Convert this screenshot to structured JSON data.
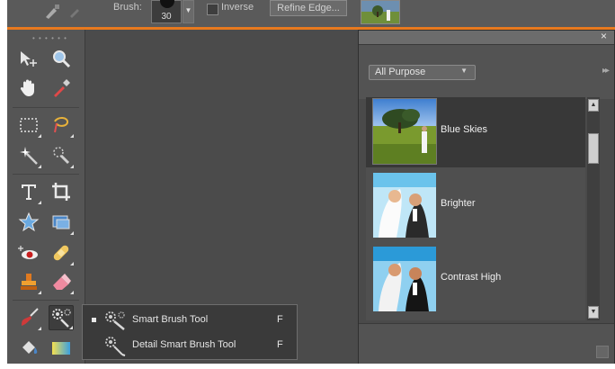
{
  "options_bar": {
    "brush_label": "Brush:",
    "brush_size": "30",
    "inverse_label": "Inverse",
    "refine_edge_label": "Refine Edge..."
  },
  "tools": [
    {
      "name": "move-tool-icon"
    },
    {
      "name": "zoom-tool-icon"
    },
    {
      "name": "hand-tool-icon"
    },
    {
      "name": "eyedropper-tool-icon"
    },
    {
      "name": "marquee-tool-icon"
    },
    {
      "name": "lasso-tool-icon"
    },
    {
      "name": "magic-wand-tool-icon"
    },
    {
      "name": "quick-selection-tool-icon"
    },
    {
      "name": "type-tool-icon"
    },
    {
      "name": "crop-tool-icon"
    },
    {
      "name": "cookie-cutter-tool-icon"
    },
    {
      "name": "straighten-tool-icon"
    },
    {
      "name": "red-eye-tool-icon"
    },
    {
      "name": "healing-brush-tool-icon"
    },
    {
      "name": "clone-stamp-tool-icon"
    },
    {
      "name": "eraser-tool-icon"
    },
    {
      "name": "brush-tool-icon"
    },
    {
      "name": "smart-brush-tool-icon"
    },
    {
      "name": "paint-bucket-tool-icon"
    },
    {
      "name": "gradient-tool-icon"
    }
  ],
  "flyout": {
    "items": [
      {
        "label": "Smart Brush Tool",
        "shortcut": "F",
        "selected": true
      },
      {
        "label": "Detail Smart Brush Tool",
        "shortcut": "F",
        "selected": false
      }
    ]
  },
  "effects_panel": {
    "close_icon": "×",
    "category_dropdown": "All Purpose",
    "items": [
      {
        "label": "Blue Skies",
        "selected": true
      },
      {
        "label": "Brighter",
        "selected": false
      },
      {
        "label": "Contrast High",
        "selected": false
      }
    ]
  },
  "colors": {
    "accent": "#e8791e",
    "panel_bg": "#4a4a4a",
    "selected_item_bg": "#383838"
  }
}
